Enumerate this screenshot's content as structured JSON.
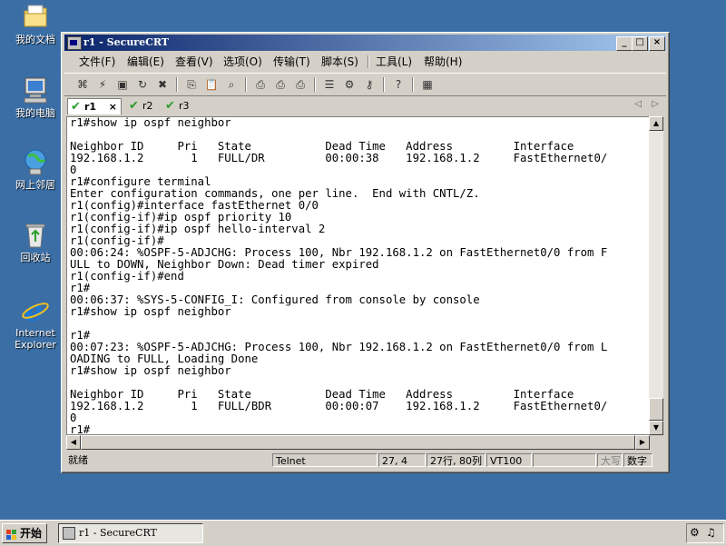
{
  "desktop": {
    "icons": [
      {
        "label": "我的文档",
        "icon": "my-documents-icon"
      },
      {
        "label": "我的电脑",
        "icon": "my-computer-icon"
      },
      {
        "label": "网上邻居",
        "icon": "network-places-icon"
      },
      {
        "label": "回收站",
        "icon": "recycle-bin-icon"
      },
      {
        "label": "Internet Explorer",
        "icon": "internet-explorer-icon"
      }
    ]
  },
  "window": {
    "title": "r1 - SecureCRT",
    "controls": {
      "minimize": "_",
      "maximize": "□",
      "close": "×"
    }
  },
  "menu": [
    "文件(F)",
    "编辑(E)",
    "查看(V)",
    "选项(O)",
    "传输(T)",
    "脚本(S)",
    "工具(L)",
    "帮助(H)"
  ],
  "tabs": [
    {
      "label": "r1",
      "active": true,
      "close": "×"
    },
    {
      "label": "r2",
      "active": false
    },
    {
      "label": "r3",
      "active": false
    }
  ],
  "terminal": {
    "lines": [
      "r1#show ip ospf neighbor",
      "",
      "Neighbor ID     Pri   State           Dead Time   Address         Interface",
      "192.168.1.2       1   FULL/DR         00:00:38    192.168.1.2     FastEthernet0/",
      "0",
      "r1#configure terminal",
      "Enter configuration commands, one per line.  End with CNTL/Z.",
      "r1(config)#interface fastEthernet 0/0",
      "r1(config-if)#ip ospf priority 10",
      "r1(config-if)#ip ospf hello-interval 2",
      "r1(config-if)#",
      "00:06:24: %OSPF-5-ADJCHG: Process 100, Nbr 192.168.1.2 on FastEthernet0/0 from F",
      "ULL to DOWN, Neighbor Down: Dead timer expired",
      "r1(config-if)#end",
      "r1#",
      "00:06:37: %SYS-5-CONFIG_I: Configured from console by console",
      "r1#show ip ospf neighbor",
      "",
      "r1#",
      "00:07:23: %OSPF-5-ADJCHG: Process 100, Nbr 192.168.1.2 on FastEthernet0/0 from L",
      "OADING to FULL, Loading Done",
      "r1#show ip ospf neighbor",
      "",
      "Neighbor ID     Pri   State           Dead Time   Address         Interface",
      "192.168.1.2       1   FULL/BDR        00:00:07    192.168.1.2     FastEthernet0/",
      "0",
      "r1#"
    ]
  },
  "status": {
    "ready": "就绪",
    "protocol": "Telnet",
    "cursor": "27, 4",
    "rows_cols": "27行, 80列",
    "emulation": "VT100",
    "caps": "大写",
    "num": "数字"
  },
  "taskbar": {
    "start": "开始",
    "task": "r1 - SecureCRT"
  }
}
